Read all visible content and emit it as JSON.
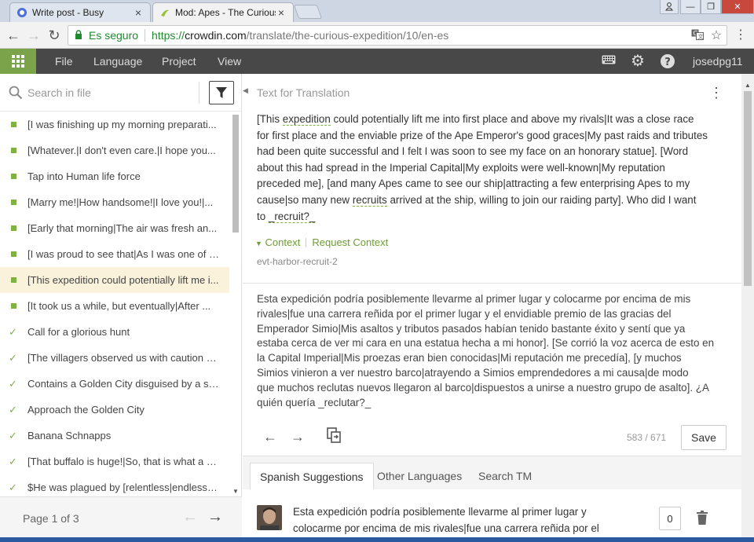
{
  "browser": {
    "tabs": [
      {
        "title": "Write post - Busy",
        "active": false
      },
      {
        "title": "Mod: Apes - The Curious",
        "active": true
      }
    ],
    "secure_label": "Es seguro",
    "url_https": "https://",
    "url_host": "crowdin.com",
    "url_path": "/translate/the-curious-expedition/10/en-es"
  },
  "app": {
    "menu": [
      "File",
      "Language",
      "Project",
      "View"
    ],
    "username": "josedpg11"
  },
  "left_panel": {
    "search_placeholder": "Search in file",
    "strings": [
      {
        "text": "[I was finishing up my morning preparati...",
        "status": "untranslated"
      },
      {
        "text": "[Whatever.|I don't even care.|I hope you...",
        "status": "untranslated"
      },
      {
        "text": "Tap into Human life force",
        "status": "untranslated"
      },
      {
        "text": "[Marry me!|How handsome!|I love you!|...",
        "status": "untranslated"
      },
      {
        "text": "[Early that morning|The air was fresh an...",
        "status": "untranslated"
      },
      {
        "text": "[I was proud to see that|As I was one of t...",
        "status": "untranslated"
      },
      {
        "text": "[This expedition could potentially lift me i...",
        "status": "selected"
      },
      {
        "text": "[It took us a while, but eventually|After ...",
        "status": "untranslated"
      },
      {
        "text": "Call for a glorious hunt",
        "status": "approved"
      },
      {
        "text": "[The villagers observed us with caution a...",
        "status": "approved"
      },
      {
        "text": "Contains a Golden City disguised by a sh...",
        "status": "approved"
      },
      {
        "text": "Approach the Golden City",
        "status": "approved"
      },
      {
        "text": "Banana Schnapps",
        "status": "approved"
      },
      {
        "text": "[That buffalo is huge!|So, that is what a b...",
        "status": "approved"
      },
      {
        "text": "$He was plagued by [relentless|endless] ...",
        "status": "approved"
      }
    ],
    "pager_label": "Page 1 of 3"
  },
  "editor": {
    "source_label": "Text for Translation",
    "source_lines": [
      "[This expedition could potentially lift me into first place and above my rivals|It was a close race",
      "for first place and the enviable prize of the Ape Emperor's good graces|My past raids and tributes",
      "had been quite successful and I felt I was soon to see my face on an honorary statue]. [Word",
      "about this had spread in the Imperial Capital|My exploits were well-known|My reputation",
      "preceded me], [and many Apes came to see our ship|attracting a few enterprising Apes to my",
      "cause|so many new recruits arrived at the ship, willing to join our raiding party]. Who did I want",
      "to _recruit?_"
    ],
    "context_label": "Context",
    "request_context_label": "Request Context",
    "string_key": "evt-harbor-recruit-2",
    "translation_lines": [
      "Esta expedición podría posiblemente llevarme al primer lugar y colocarme por encima de mis",
      "rivales|fue una carrera reñida por el primer lugar y el envidiable premio de las gracias del",
      "Emperador Simio|Mis asaltos y tributos pasados habían tenido bastante éxito y sentí que ya",
      "estaba cerca de ver mi cara en una estatua hecha a mi honor]. [Se corrió la voz acerca de esto en",
      "la Capital Imperial|Mis proezas eran bien conocidas|Mi reputación me precedía], [y muchos",
      "Simios vinieron a ver nuestro barco|atrayendo a Simios emprendedores a mi causa|de modo",
      "que muchos reclutas nuevos llegaron al barco|dispuestos a unirse a nuestro grupo de asalto]. ¿A",
      "quién quería _reclutar?_"
    ],
    "char_count": "583 / 671",
    "save_label": "Save"
  },
  "suggestions": {
    "tabs": [
      "Spanish Suggestions",
      "Other Languages",
      "Search TM"
    ],
    "items": [
      {
        "lines": [
          "Esta expedición podría posiblemente llevarme al primer lugar y",
          "colocarme por encima de mis rivales|fue una carrera reñida por el"
        ],
        "votes": "0"
      }
    ]
  },
  "colors": {
    "brand_green": "#7ba44a",
    "header_dark": "#484848",
    "selected_row": "#fbf2dc",
    "link_green": "#6d9c33"
  }
}
